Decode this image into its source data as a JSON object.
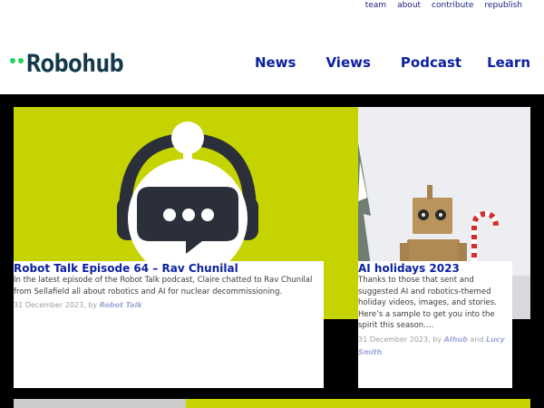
{
  "toplinks": {
    "team": "team",
    "about": "about",
    "contribute": "contribute",
    "republish": "republish"
  },
  "logo": {
    "text": "Robohub"
  },
  "nav": {
    "news": "News",
    "views": "Views",
    "podcast": "Podcast",
    "learn": "Learn"
  },
  "colors": {
    "nav_link": "#0d21a1",
    "accent_lime": "#c5d400",
    "logo_dots": "#23d160",
    "logo_text": "#13394b"
  },
  "articles": [
    {
      "title": "Robot Talk Episode 64 – Rav Chunilal",
      "excerpt": "In the latest episode of the Robot Talk podcast, Claire chatted to Rav Chunilal from Sellafield all about robotics and AI for nuclear decommissioning.",
      "date": "31 December 2023",
      "by": ", by ",
      "author1": "Robot Talk"
    },
    {
      "title": "AI holidays 2023",
      "excerpt": "Thanks to those that sent and suggested AI and robotics-themed holiday videos, images, and stories. Here’s a sample to get you into the spirit this season.…",
      "date": "31 December 2023",
      "by": ", by ",
      "author1": "AIhub",
      "and": " and ",
      "author2": "Lucy Smith"
    }
  ]
}
